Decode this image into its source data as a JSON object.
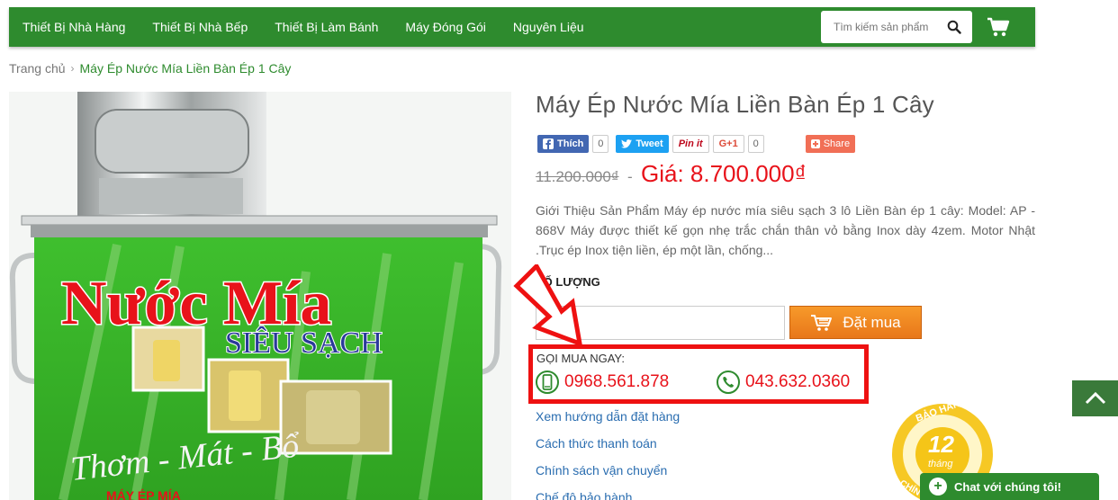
{
  "nav": {
    "items": [
      "Thiết Bị Nhà Hàng",
      "Thiết Bị Nhà Bếp",
      "Thiết Bị Làm Bánh",
      "Máy Đóng Gói",
      "Nguyên Liệu"
    ],
    "search_placeholder": "Tìm kiếm sản phẩm"
  },
  "breadcrumb": {
    "home": "Trang chủ",
    "separator": "›",
    "current": "Máy Ép Nước Mía Liền Bàn Ép 1 Cây"
  },
  "product": {
    "title": "Máy Ép Nước Mía Liền Bàn Ép 1 Cây",
    "old_price": "11.200.000₫",
    "price_separator": "-",
    "price": "Giá: 8.700.000₫",
    "description": "Giới Thiệu Sản Phẩm Máy ép nước mía siêu sạch 3 lô Liền Bàn ép 1 cây: Model: AP - 868V Máy được thiết kế gọn nhẹ trắc chắn thân vỏ bằng Inox dày 4zem. Motor Nhật .Trục ép Inox tiện liền, ép một lần, chống...",
    "quantity_label": "SỐ LƯỢNG",
    "quantity_value": "1",
    "buy_label": "Đặt mua"
  },
  "image": {
    "main_text": "Nước Mía",
    "sub_text": "SIÊU SẠCH",
    "slogan": "Thơm - Mát - Bổ",
    "bottom_text": "MÁY ÉP MÍA"
  },
  "social": {
    "facebook_label": "Thích",
    "facebook_count": "0",
    "tweet_label": "Tweet",
    "pin_label": "Pin it",
    "gplus_label": "G+1",
    "gplus_count": "0",
    "share_label": "Share"
  },
  "call": {
    "label": "GỌI MUA NGAY:",
    "phone1": "0968.561.878",
    "phone2": "043.632.0360"
  },
  "links": [
    "Xem hướng dẫn đặt hàng",
    "Cách thức thanh toán",
    "Chính sách vận chuyển",
    "Chế độ bảo hành"
  ],
  "warranty": {
    "top": "BẢO HÀNH",
    "number": "12",
    "unit": "tháng",
    "bottom": "CHÍN"
  },
  "chat_label": "Chat với chúng tôi!",
  "colors": {
    "brand_green": "#2e8b2e",
    "price_red": "#e8121a",
    "buy_orange": "#f08a24",
    "link_blue": "#2a6db0"
  }
}
